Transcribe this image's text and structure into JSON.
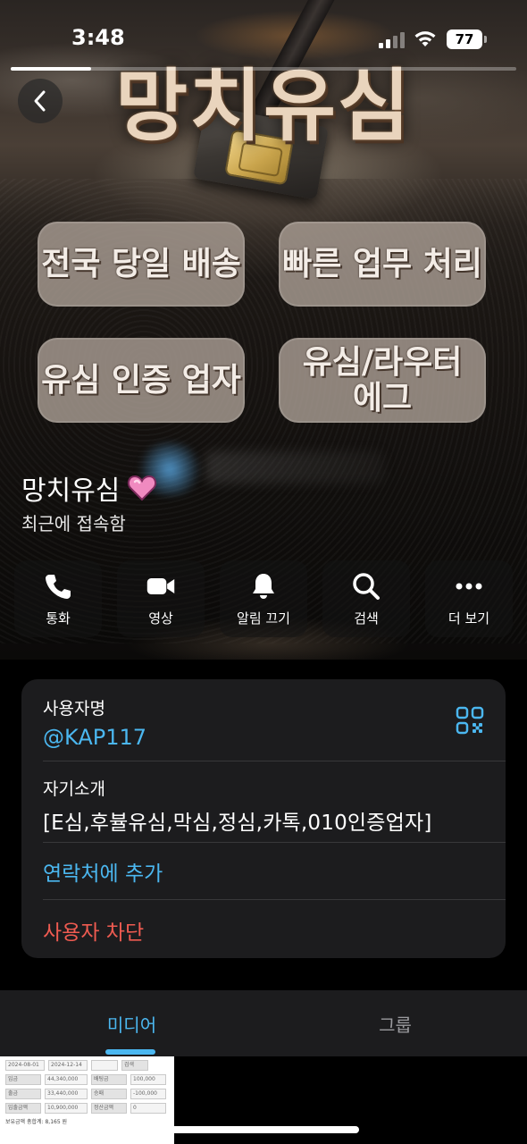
{
  "status_bar": {
    "time": "3:48",
    "battery": "77"
  },
  "hero": {
    "title": "망치유심",
    "badges": [
      "전국 당일 배송",
      "빠른 업무 처리",
      "유심 인증 업자",
      "유심/라우터\n에그"
    ]
  },
  "profile": {
    "name": "망치유심",
    "name_emoji_icon": "pink-heart-icon",
    "status": "최근에 접속함"
  },
  "actions": [
    {
      "label": "통화",
      "icon": "phone-icon"
    },
    {
      "label": "영상",
      "icon": "video-icon"
    },
    {
      "label": "알림 끄기",
      "icon": "bell-icon"
    },
    {
      "label": "검색",
      "icon": "search-icon"
    },
    {
      "label": "더 보기",
      "icon": "more-icon"
    }
  ],
  "info": {
    "username_label": "사용자명",
    "username": "@KAP117",
    "bio_label": "자기소개",
    "bio": "[E심,후뷸유심,막심,정심,카톡,010인증업자]",
    "add_contact": "연락처에 추가",
    "block_user": "사용자 차단"
  },
  "tabs": {
    "media": "미디어",
    "group": "그룹",
    "active": "media"
  },
  "media_thumb": {
    "date_from": "2024-08-01",
    "date_to": "2024-12-14",
    "search_btn": "검색",
    "rows": [
      [
        "입금",
        "44,340,000",
        "배팅금",
        "100,000"
      ],
      [
        "출금",
        "33,440,000",
        "승패",
        "-100,000"
      ],
      [
        "입출금액",
        "10,900,000",
        "정산금액",
        "0"
      ]
    ],
    "footer": "보유금액 총합계: 8,165 원"
  },
  "colors": {
    "accent_blue": "#4bb7f0",
    "danger_red": "#ef5b51",
    "card_bg": "#1c1c1e"
  }
}
